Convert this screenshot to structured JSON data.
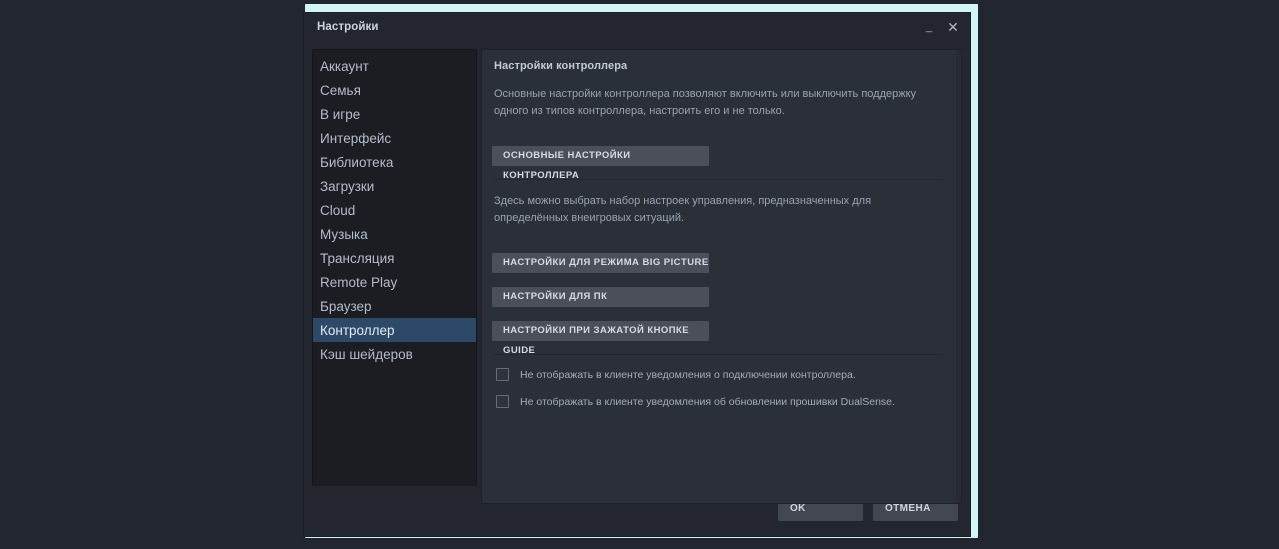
{
  "window": {
    "title": "Настройки",
    "minimize_icon": "minimize-icon",
    "minimize_glyph": "_",
    "close_icon": "close-icon",
    "close_glyph": "✕",
    "accent_color": "#d2f6f6",
    "background_color": "#23262e",
    "selected_item_color": "#2c4967"
  },
  "sidebar": {
    "items": [
      {
        "label": "Аккаунт",
        "selected": false
      },
      {
        "label": "Семья",
        "selected": false
      },
      {
        "label": "В игре",
        "selected": false
      },
      {
        "label": "Интерфейс",
        "selected": false
      },
      {
        "label": "Библиотека",
        "selected": false
      },
      {
        "label": "Загрузки",
        "selected": false
      },
      {
        "label": "Cloud",
        "selected": false
      },
      {
        "label": "Музыка",
        "selected": false
      },
      {
        "label": "Трансляция",
        "selected": false
      },
      {
        "label": "Remote Play",
        "selected": false
      },
      {
        "label": "Браузер",
        "selected": false
      },
      {
        "label": "Контроллер",
        "selected": true
      },
      {
        "label": "Кэш шейдеров",
        "selected": false
      }
    ]
  },
  "content": {
    "heading": "Настройки контроллера",
    "description_1": "Основные настройки контроллера позволяют включить или выключить поддержку одного из типов контроллера, настроить его и не только.",
    "primary_button": "ОСНОВНЫЕ НАСТРОЙКИ КОНТРОЛЛЕРА",
    "description_2": "Здесь можно выбрать набор настроек управления, предназначенных для определённых внеигровых ситуаций.",
    "config_buttons": [
      {
        "label": "НАСТРОЙКИ ДЛЯ РЕЖИМА BIG PICTURE"
      },
      {
        "label": "НАСТРОЙКИ ДЛЯ ПК"
      },
      {
        "label": "НАСТРОЙКИ ПРИ ЗАЖАТОЙ КНОПКЕ GUIDE"
      }
    ],
    "checkboxes": [
      {
        "label": "Не отображать в клиенте уведомления о подключении контроллера.",
        "checked": false
      },
      {
        "label": "Не отображать в клиенте уведомления об обновлении прошивки DualSense.",
        "checked": false
      }
    ]
  },
  "footer": {
    "ok_label": "OK",
    "cancel_label": "ОТМЕНА"
  }
}
